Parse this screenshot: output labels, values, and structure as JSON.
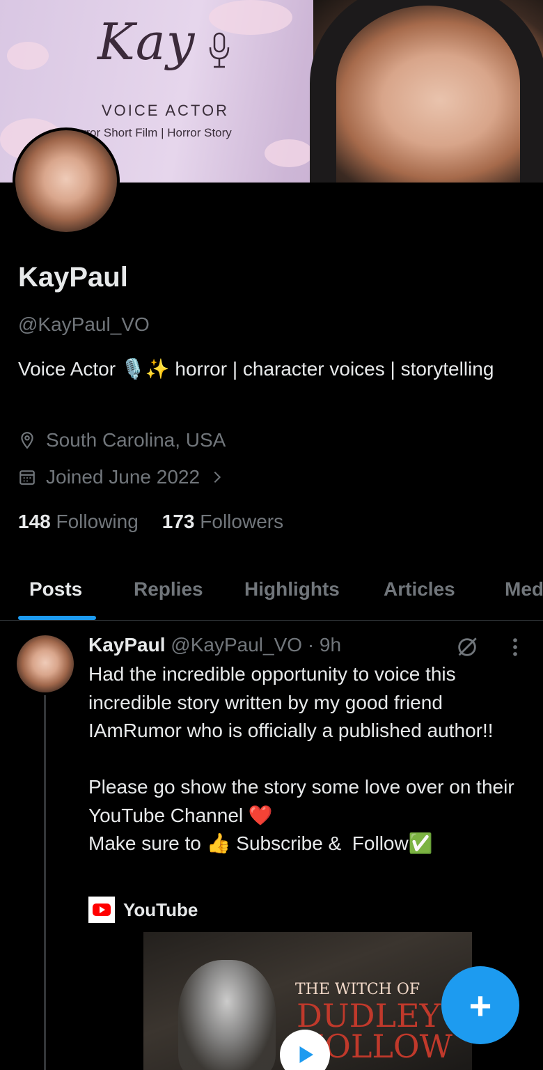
{
  "banner": {
    "title": "Kay",
    "role": "VOICE ACTOR",
    "subtitle": "Horror Short Film | Horror Story"
  },
  "profile": {
    "display_name": "KayPaul",
    "handle": "@KayPaul_VO",
    "bio": "Voice Actor 🎙️✨ horror | character voices | storytelling",
    "location": "South Carolina, USA",
    "joined": "Joined June 2022",
    "following_count": "148",
    "following_label": "Following",
    "followers_count": "173",
    "followers_label": "Followers"
  },
  "tabs": [
    {
      "label": "Posts",
      "active": true
    },
    {
      "label": "Replies",
      "active": false
    },
    {
      "label": "Highlights",
      "active": false
    },
    {
      "label": "Articles",
      "active": false
    },
    {
      "label": "Media",
      "active": false
    }
  ],
  "post": {
    "author": "KayPaul",
    "handle": "@KayPaul_VO",
    "time": "· 9h",
    "text": "Had the incredible opportunity to voice this incredible story written by my good friend IAmRumor who is officially a published author!!\n\nPlease go show the story some love over on their YouTube Channel ❤️\nMake sure to 👍 Subscribe &  Follow✅",
    "link_source": "YouTube",
    "thumbnail_title_1": "THE WITCH OF",
    "thumbnail_title_2": "DUDLEY HOLLOW"
  },
  "fab_label": "+",
  "colors": {
    "background": "#000000",
    "accent": "#1d9bf0",
    "secondary_text": "#71767b",
    "youtube_red": "#ff0000"
  },
  "icons": [
    "location-pin-icon",
    "calendar-icon",
    "chevron-right-icon",
    "grok-icon",
    "more-icon",
    "youtube-icon",
    "play-icon",
    "compose-plus-icon",
    "microphone-icon"
  ]
}
